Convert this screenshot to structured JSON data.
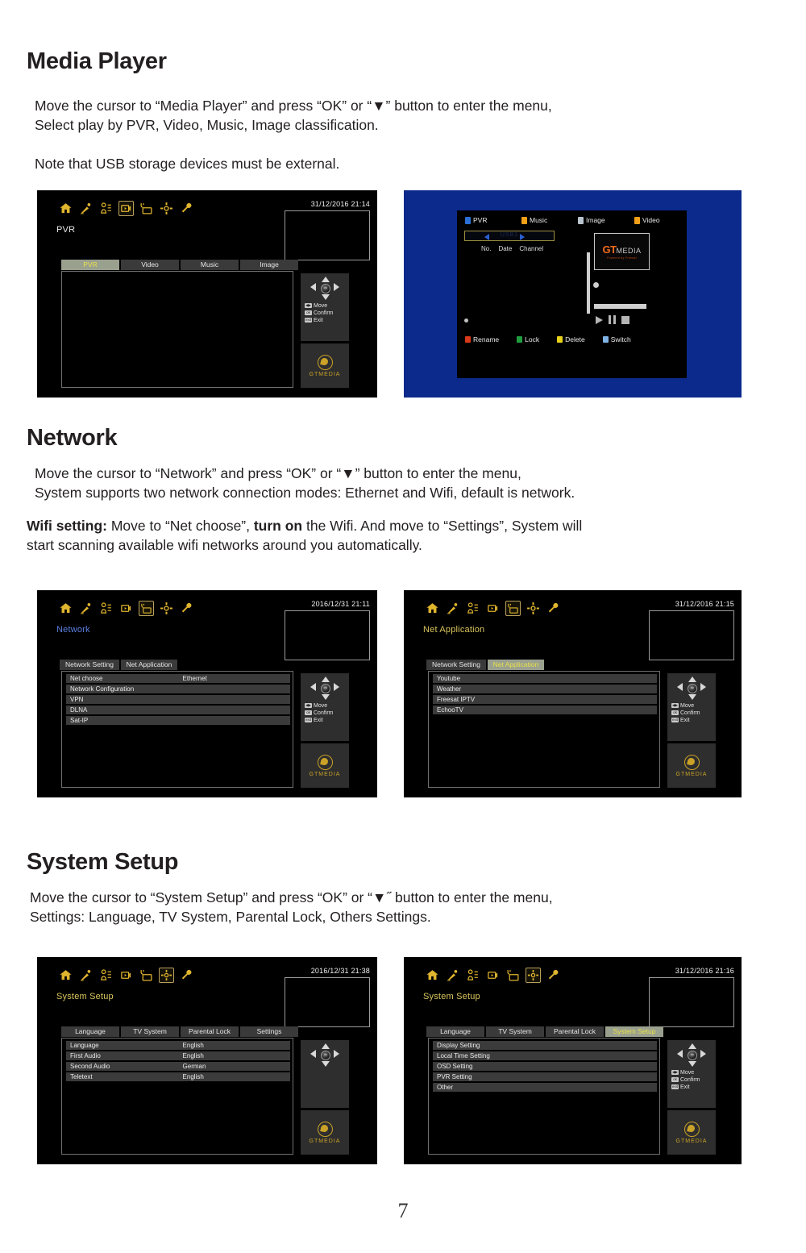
{
  "document": {
    "page_number": "7",
    "sections": [
      {
        "title": "Media Player",
        "paragraphs": [
          "Move the cursor to “Media Player” and press “OK” or “▼” button to enter the menu,\nSelect play by PVR, Video, Music, Image classification.",
          "Note that USB storage devices must be external."
        ]
      },
      {
        "title": "Network",
        "paragraphs": [
          "Move the cursor to “Network” and press “OK” or “▼” button to enter the menu,\nSystem supports two network connection modes: Ethernet and Wifi, default is network."
        ],
        "rich_paragraph": {
          "lead": "Wifi setting:",
          "mid": " Move to “Net choose”, ",
          "bold2": "turn on",
          "tail": " the Wifi. And move to “Settings”, System will\nstart scanning available wifi networks around you automatically."
        }
      },
      {
        "title": "System Setup",
        "paragraphs": [
          "Move the cursor to “System Setup” and press “OK” or “▼˝  button to enter the menu,\nSettings: Language, TV System, Parental Lock, Others Settings."
        ]
      }
    ]
  },
  "colors": {
    "accent_yellow": "#d9c45c",
    "tab_active_bg": "#9aa08e",
    "tab_active_text": "#e8e14a",
    "blue_frame": "#0b2a8c",
    "logo_gold": "#c9a227",
    "red": "#d8391b",
    "green": "#1f9d3f",
    "yellow": "#e8d21a",
    "blue": "#7fb2e5",
    "orange": "#f3a019"
  },
  "icon_bar": {
    "icons": [
      {
        "name": "home-icon",
        "label": "Home"
      },
      {
        "name": "satellite-dish-icon",
        "label": "Installation"
      },
      {
        "name": "channel-list-icon",
        "label": "Channel"
      },
      {
        "name": "media-player-icon",
        "label": "Media Player"
      },
      {
        "name": "network-icon",
        "label": "Network"
      },
      {
        "name": "settings-gear-icon",
        "label": "System Setup"
      },
      {
        "name": "wrench-icon",
        "label": "Tools"
      }
    ]
  },
  "nav_hints": {
    "move": "Move",
    "confirm": "Confirm",
    "exit": "Exit",
    "move_key": "◀▶",
    "confirm_key": "ok",
    "exit_key": "exit"
  },
  "brand": {
    "logo_text": "GTMEDIA",
    "player_logo_gt": "GT",
    "player_logo_media": "MEDIA",
    "player_logo_sub": "Powered by Freesat"
  },
  "screens": {
    "media_player_pvr": {
      "selected_icon_index": 3,
      "clock": "31/12/2016  21:14",
      "title": "PVR",
      "tabs": [
        {
          "label": "PVR",
          "active": true
        },
        {
          "label": "Video",
          "active": false
        },
        {
          "label": "Music",
          "active": false
        },
        {
          "label": "Image",
          "active": false
        }
      ],
      "rows": []
    },
    "pvr_player": {
      "tabs": [
        {
          "label": "PVR",
          "chip": "#2b6fd6"
        },
        {
          "label": "Music",
          "chip": "#f3a019"
        },
        {
          "label": "Image",
          "chip": "#b9c4cf"
        },
        {
          "label": "Video",
          "chip": "#f3a019"
        }
      ],
      "device_selector": "USB1",
      "columns": [
        "No.",
        "Date",
        "Channel"
      ],
      "color_buttons": [
        {
          "label": "Rename",
          "color": "#d8391b"
        },
        {
          "label": "Lock",
          "color": "#1f9d3f"
        },
        {
          "label": "Delete",
          "color": "#e8d21a"
        },
        {
          "label": "Switch",
          "color": "#7fb2e5"
        }
      ],
      "transport": [
        "play",
        "pause",
        "stop"
      ]
    },
    "network_setting": {
      "selected_icon_index": 4,
      "clock": "2016/12/31  21:11",
      "title": "Network",
      "tabs": [
        {
          "label": "Network Setting",
          "active": false
        },
        {
          "label": "Net Application",
          "active": false
        }
      ],
      "rows": [
        {
          "label": "Net choose",
          "value": "Ethernet"
        },
        {
          "label": "Network Configuration",
          "value": ""
        },
        {
          "label": "VPN",
          "value": ""
        },
        {
          "label": "DLNA",
          "value": ""
        },
        {
          "label": "Sat-IP",
          "value": ""
        }
      ]
    },
    "net_application": {
      "selected_icon_index": 4,
      "clock": "31/12/2016  21:15",
      "title": "Net Application",
      "tabs": [
        {
          "label": "Network Setting",
          "active": false
        },
        {
          "label": "Net Application",
          "active": true
        }
      ],
      "rows": [
        {
          "label": "Youtube",
          "value": ""
        },
        {
          "label": "Weather",
          "value": ""
        },
        {
          "label": "Freesat IPTV",
          "value": ""
        },
        {
          "label": "EchooTV",
          "value": ""
        }
      ]
    },
    "system_setup_language": {
      "selected_icon_index": 5,
      "clock": "2016/12/31  21:38",
      "title": "System Setup",
      "tabs": [
        {
          "label": "Language",
          "active": false
        },
        {
          "label": "TV System",
          "active": false
        },
        {
          "label": "Parental Lock",
          "active": false
        },
        {
          "label": "Settings",
          "active": false
        }
      ],
      "rows": [
        {
          "label": "Language",
          "value": "English"
        },
        {
          "label": "First Audio",
          "value": "English"
        },
        {
          "label": "Second Audio",
          "value": "German"
        },
        {
          "label": "Teletext",
          "value": "English"
        }
      ],
      "show_hints": false
    },
    "system_setup_others": {
      "selected_icon_index": 5,
      "clock": "31/12/2016  21:16",
      "title": "System Setup",
      "tabs": [
        {
          "label": "Language",
          "active": false
        },
        {
          "label": "TV System",
          "active": false
        },
        {
          "label": "Parental Lock",
          "active": false
        },
        {
          "label": "System Setup",
          "active": true
        }
      ],
      "rows": [
        {
          "label": "Display Setting",
          "value": ""
        },
        {
          "label": "Local Time Setting",
          "value": ""
        },
        {
          "label": "OSD Setting",
          "value": ""
        },
        {
          "label": "PVR Setting",
          "value": ""
        },
        {
          "label": "Other",
          "value": ""
        }
      ],
      "show_hints": true
    }
  }
}
